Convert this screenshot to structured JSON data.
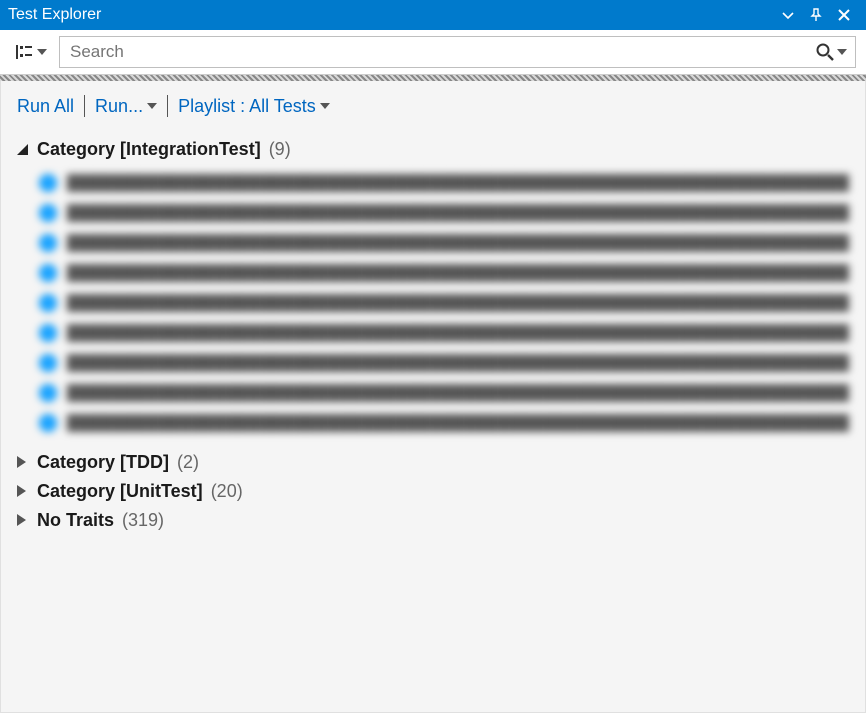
{
  "window": {
    "title": "Test Explorer"
  },
  "search": {
    "placeholder": "Search"
  },
  "actions": {
    "run_all": "Run All",
    "run": "Run...",
    "playlist": "Playlist : All Tests"
  },
  "tree": {
    "groups": [
      {
        "label": "Category [IntegrationTest]",
        "count": "(9)",
        "expanded": true,
        "items": [
          {
            "name": "████████████████████████████████████████████████████████████████████████████████"
          },
          {
            "name": "████████████████████████████████████████████████████████████████████████████████"
          },
          {
            "name": "████████████████████████████████████████████████████████████████████████████████"
          },
          {
            "name": "████████████████████████████████████████████████████████████████████████████████"
          },
          {
            "name": "████████████████████████████████████████████████████████████████████████████████"
          },
          {
            "name": "████████████████████████████████████████████████████████████████████████████████"
          },
          {
            "name": "████████████████████████████████████████████████████████████████████████████████"
          },
          {
            "name": "████████████████████████████████████████████████████████████████████████████████"
          },
          {
            "name": "████████████████████████████████████████████████████████████████████████████████"
          }
        ]
      },
      {
        "label": "Category [TDD]",
        "count": "(2)",
        "expanded": false
      },
      {
        "label": "Category [UnitTest]",
        "count": "(20)",
        "expanded": false
      },
      {
        "label": "No Traits",
        "count": "(319)",
        "expanded": false
      }
    ]
  }
}
